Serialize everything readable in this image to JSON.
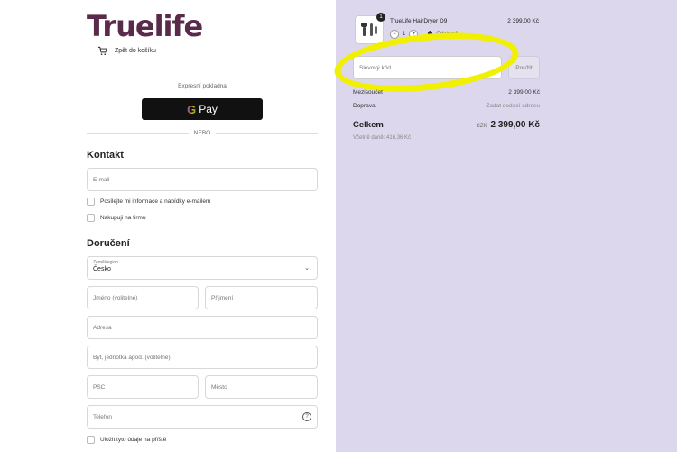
{
  "brand": {
    "logo_text": "Truelife"
  },
  "back_link": {
    "label": "Zpět do košíku"
  },
  "express": {
    "label": "Expresní pokladna",
    "gpay_label": "Pay",
    "g_letter": "G",
    "or_text": "NEBO"
  },
  "contact": {
    "title": "Kontakt",
    "email_placeholder": "E-mail",
    "newsletter_label": "Posílejte mi informace a nabídky e-mailem",
    "company_label": "Nakupuji na firmu"
  },
  "delivery": {
    "title": "Doručení",
    "country_label": "Země/region",
    "country_value": "Česko",
    "first_name_placeholder": "Jméno (volitelné)",
    "last_name_placeholder": "Příjmení",
    "address_placeholder": "Adresa",
    "apartment_placeholder": "Byt, jednotka apod. (volitelné)",
    "zip_placeholder": "PSČ",
    "city_placeholder": "Město",
    "phone_placeholder": "Telefon",
    "save_label": "Uložit tyto údaje na příště"
  },
  "order": {
    "product_name": "TrueLife HairDryer D9",
    "product_price": "2 399,00 Kč",
    "quantity_badge": "1",
    "quantity": "1",
    "minus": "−",
    "plus": "+",
    "remove_label": "Odstranit",
    "discount_placeholder": "Slevový kód",
    "apply_label": "Použít",
    "subtotal_label": "Mezisoučet",
    "subtotal_value": "2 399,00 Kč",
    "shipping_label": "Doprava",
    "shipping_value": "Zadat dodací adresu",
    "total_label": "Celkem",
    "currency": "CZK",
    "total_value": "2 399,00 Kč",
    "tax_note": "Včetně daně: 416,36 Kč"
  },
  "colors": {
    "brand": "#5a2a4a",
    "right_panel_bg": "#dcd7ec",
    "highlight": "#f0f000",
    "gpay_bg": "#111111"
  },
  "icons": [
    "cart-icon",
    "trash-icon",
    "chevron-down-icon",
    "help-icon",
    "hairdryer-icon"
  ]
}
